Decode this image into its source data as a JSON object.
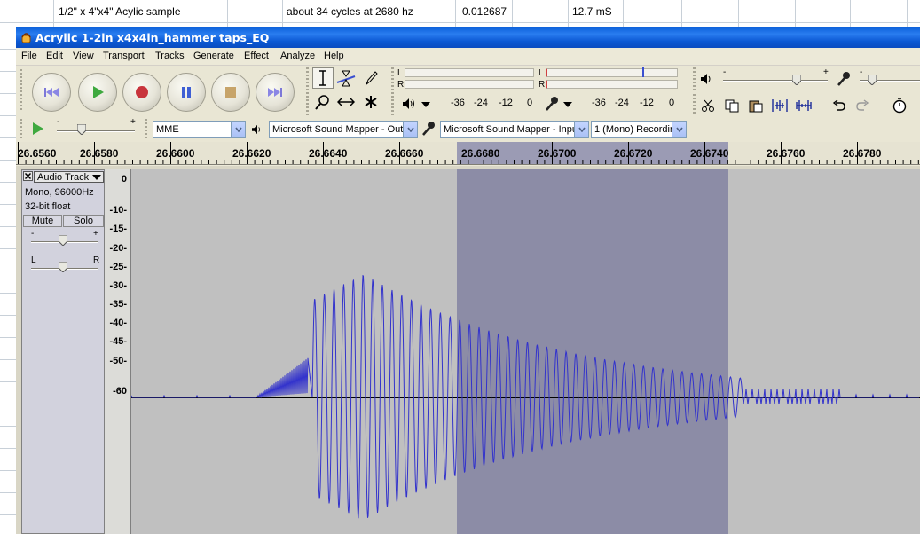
{
  "spreadsheet": {
    "cells": [
      "1/2\" x 4\"x4\" Acylic sample",
      "about 34 cycles at 2680 hz",
      "0.012687",
      "12.7 mS"
    ]
  },
  "window": {
    "title": "Acrylic 1-2in x4x4in_hammer taps_EQ"
  },
  "menu": [
    "File",
    "Edit",
    "View",
    "Transport",
    "Tracks",
    "Generate",
    "Effect",
    "Analyze",
    "Help"
  ],
  "transport": {
    "buttons": [
      "skip-to-start",
      "play",
      "record",
      "pause",
      "stop",
      "skip-to-end"
    ]
  },
  "meters": {
    "left_label": "L",
    "right_label": "R",
    "output_scale": [
      "-36",
      "-24",
      "-12",
      "0"
    ],
    "input_scale": [
      "-36",
      "-24",
      "-12",
      "0"
    ]
  },
  "device": {
    "host": "MME",
    "output": "Microsoft Sound Mapper - Outp",
    "input": "Microsoft Sound Mapper - Inpu",
    "channels": "1 (Mono) Recordir"
  },
  "ruler": {
    "ticks": [
      "26.6560",
      "26.6580",
      "26.6600",
      "26.6620",
      "26.6640",
      "26.6660",
      "26.6680",
      "26.6700",
      "26.6720",
      "26.6740",
      "26.6760",
      "26.6780"
    ]
  },
  "track": {
    "name": "Audio Track",
    "format": "Mono, 96000Hz",
    "bit_depth": "32-bit float",
    "mute_label": "Mute",
    "solo_label": "Solo",
    "gain_minus": "-",
    "gain_plus": "+",
    "pan_left": "L",
    "pan_right": "R"
  },
  "db_scale": [
    "0",
    "-10-",
    "-15-",
    "-20-",
    "-25-",
    "-30-",
    "-35-",
    "-40-",
    "-45-",
    "-50-",
    "-60"
  ],
  "colors": {
    "waveform": "#3333cc",
    "selection": "#8c8ca6",
    "track_bg": "#c0c0c0",
    "titlebar": "#0a55d0"
  }
}
